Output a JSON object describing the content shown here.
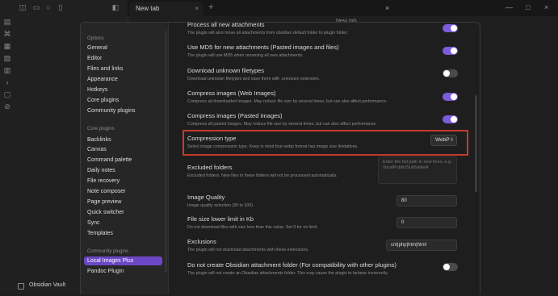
{
  "tab": {
    "title": "New tab",
    "close": "×",
    "new": "+"
  },
  "background": {
    "newtab_title": "New tab"
  },
  "window": {
    "minimize": "—",
    "maximize": "□",
    "close": "×"
  },
  "vault": {
    "name": "Obsidian Vault"
  },
  "nav": {
    "options_header": "Options",
    "options": [
      "General",
      "Editor",
      "Files and links",
      "Appearance",
      "Hotkeys",
      "Core plugins",
      "Community plugins"
    ],
    "core_header": "Core plugins",
    "core": [
      "Backlinks",
      "Canvas",
      "Command palette",
      "Daily notes",
      "File recovery",
      "Note composer",
      "Page preview",
      "Quick switcher",
      "Sync",
      "Templates"
    ],
    "community_header": "Community plugins",
    "community": [
      "Local Images Plus",
      "Pandoc Plugin"
    ]
  },
  "modal": {
    "close": "×"
  },
  "settings": {
    "s1": {
      "name": "Process all new attachments",
      "desc": "The plugin will also move all attachments from obsidian default folder to plugin folder.",
      "state": "on"
    },
    "s2": {
      "name": "Use MD5 for new attachments (Pasted images and files)",
      "desc": "The plugin will use MD5 when renaming all new attachments.",
      "state": "on"
    },
    "s3": {
      "name": "Download unknown filetypes",
      "desc": "Download unknown filetypes and save them with .unknown extension.",
      "state": "off"
    },
    "s4": {
      "name": "Compress images (Web Images)",
      "desc": "Compress all downloaded images. May reduce file size by several times, but can also affect performance.",
      "state": "on"
    },
    "s5": {
      "name": "Compress images (Pasted Images)",
      "desc": "Compress all pasted images. May reduce file size by several times, but can also affect performance.",
      "state": "on"
    },
    "s6": {
      "name": "Compression type",
      "desc": "Select image compression type. Keep in mind that webp format has image size limitations.",
      "value": "WebP"
    },
    "s7": {
      "name": "Excluded folders",
      "desc": "Excluded folders. New files in these folders will not be processed automatically.",
      "placeholder": "Enter the full path in new lines, e.g. /localPublic/SubfolderA"
    },
    "s8": {
      "name": "Image Quality",
      "desc": "Image quality selection (30 to 100).",
      "value": "80"
    },
    "s9": {
      "name": "File size lower limit in Kb",
      "desc": "Do not download files with size less than this value. Set 0 for no limit.",
      "value": "0"
    },
    "s10": {
      "name": "Exclusions",
      "desc": "The plugin will not download attachments with these extensions.",
      "value": "cnt|php|htm|html"
    },
    "s11": {
      "name": "Do not create Obsidian attachment folder (For compatibility with other plugins)",
      "desc": "The plugin will not create an Obsidian attachments folder. This may cause the plugin to behave incorrectly.",
      "state": "off"
    }
  },
  "colors": {
    "accent": "#7c5cdb",
    "nav_active": "#6b47c5",
    "highlight": "#c53a2e"
  }
}
